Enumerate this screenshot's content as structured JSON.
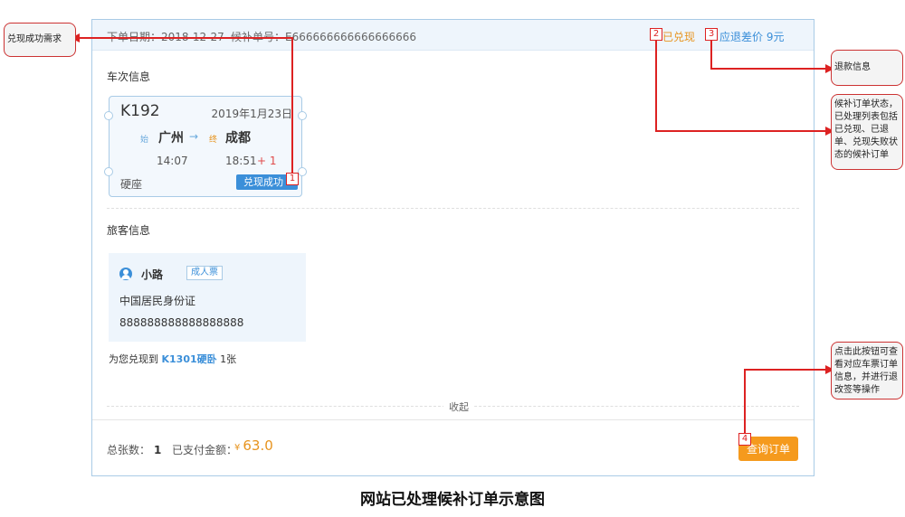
{
  "header": {
    "order_date_label": "下单日期：",
    "order_date": "2018-12-27",
    "waitlist_no_label": "候补单号：",
    "waitlist_no": "E666666666666666666",
    "status": "已兑现",
    "refund_diff": "应退差价 9元"
  },
  "train_section": {
    "title": "车次信息",
    "train_no": "K192",
    "date": "2019年1月23日",
    "from_tag": "始",
    "from": "广州",
    "arrow": "→",
    "to_tag": "终",
    "to": "成都",
    "depart_time": "14:07",
    "arrive_time": "18:51",
    "day_offset": "+ 1",
    "seat": "硬座",
    "status_badge": "兑现成功 ›"
  },
  "passenger_section": {
    "title": "旅客信息",
    "name": "小路",
    "ticket_type": "成人票",
    "id_type": "中国居民身份证",
    "id_no": "888888888888888888"
  },
  "fulfilled": {
    "prefix": "为您兑现到",
    "train": "K1301硬卧",
    "count": "1张"
  },
  "collapse_label": "收起",
  "footer": {
    "total_label": "总张数：",
    "total": "1",
    "paid_label": "已支付金额：",
    "currency": "¥",
    "paid": "63.0",
    "button": "查询订单"
  },
  "annotations": {
    "m1": "1",
    "m2": "2",
    "m3": "3",
    "m4": "4",
    "callout_success": "兑现成功需求",
    "callout_refund": "退款信息",
    "callout_status": "候补订单状态，已处理列表包括已兑现、已退单、兑现失败状态的候补订单",
    "callout_button": "点击此按钮可查看对应车票订单信息，并进行退改签等操作"
  },
  "caption": "网站已处理候补订单示意图",
  "colors": {
    "accent_blue": "#3b8fd9",
    "accent_orange": "#f59a1d",
    "annotation_red": "#dd2222"
  }
}
